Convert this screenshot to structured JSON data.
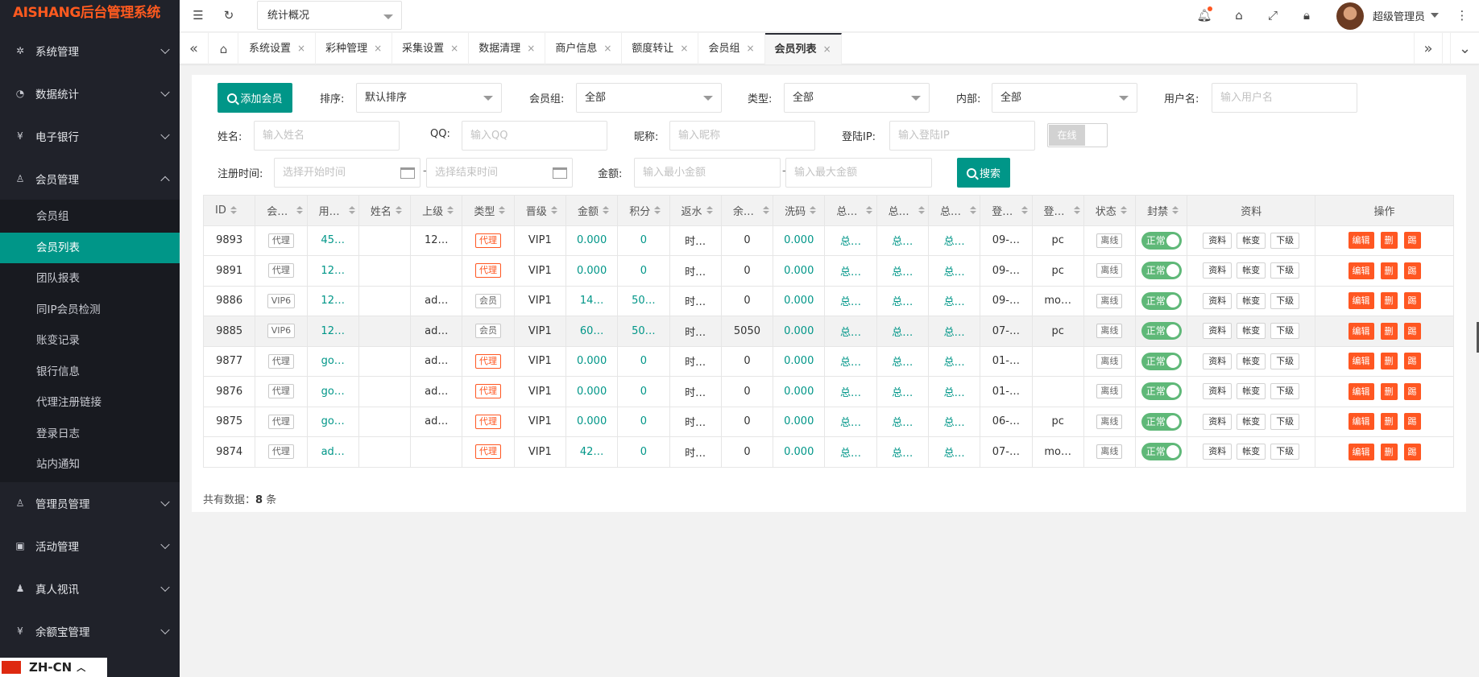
{
  "app": {
    "title": "AISHANG后台管理系统"
  },
  "sidebar": {
    "groups_top": [
      {
        "label": "系统管理",
        "icon": "gear-icon"
      },
      {
        "label": "数据统计",
        "icon": "dashboard-icon"
      },
      {
        "label": "电子银行",
        "icon": "yuan-coin-icon"
      },
      {
        "label": "会员管理",
        "icon": "user-icon",
        "expanded": true
      }
    ],
    "member_items": [
      "会员组",
      "会员列表",
      "团队报表",
      "同IP会员检测",
      "账变记录",
      "银行信息",
      "代理注册链接",
      "登录日志",
      "站内通知"
    ],
    "active_item": "会员列表",
    "groups_bottom": [
      {
        "label": "管理员管理",
        "icon": "user-icon"
      },
      {
        "label": "活动管理",
        "icon": "gift-icon"
      },
      {
        "label": "真人视讯",
        "icon": "users-icon"
      },
      {
        "label": "余额宝管理",
        "icon": "yen-icon"
      }
    ],
    "language": "ZH-CN"
  },
  "topbar": {
    "quick_select": "统计概况",
    "user_name": "超级管理员",
    "accent": "#009688"
  },
  "tabs": [
    "系统设置",
    "彩种管理",
    "采集设置",
    "数据清理",
    "商户信息",
    "额度转让",
    "会员组",
    "会员列表"
  ],
  "active_tab": "会员列表",
  "filters": {
    "add_button": "添加会员",
    "sort_label": "排序:",
    "sort_value": "默认排序",
    "group_label": "会员组:",
    "group_value": "全部",
    "type_label": "类型:",
    "type_value": "全部",
    "internal_label": "内部:",
    "internal_value": "全部",
    "username_label": "用户名:",
    "username_placeholder": "输入用户名",
    "name_label": "姓名:",
    "name_placeholder": "输入姓名",
    "qq_label": "QQ:",
    "qq_placeholder": "输入QQ",
    "nick_label": "昵称:",
    "nick_placeholder": "输入昵称",
    "ip_label": "登陆IP:",
    "ip_placeholder": "输入登陆IP",
    "online_toggle": "在线",
    "regtime_label": "注册时间:",
    "start_placeholder": "选择开始时间",
    "end_placeholder": "选择结束时间",
    "amount_label": "金额:",
    "min_placeholder": "输入最小金额",
    "max_placeholder": "输入最大金额",
    "search_button": "搜索"
  },
  "table": {
    "headers": [
      "ID",
      "会员组",
      "用户名",
      "姓名",
      "上级",
      "类型",
      "晋级",
      "金额",
      "积分",
      "返水",
      "余额宝",
      "洗码",
      "总充值",
      "总提现",
      "总投注",
      "登录时间",
      "登录设备",
      "状态",
      "封禁",
      "资料",
      "操作"
    ],
    "info_buttons": [
      "资料",
      "帐变",
      "下级"
    ],
    "op_buttons": [
      "编辑",
      "删",
      "踢"
    ],
    "rows": [
      {
        "id": "9893",
        "group": "代理",
        "user": "45…",
        "name": "",
        "parent": "12…",
        "type": "代理",
        "level": "VIP1",
        "money": "0.000",
        "points": "0",
        "rebate": "时…",
        "yeb": "0",
        "wash": "0.000",
        "dep": "总…",
        "wd": "总…",
        "bet": "总…",
        "logtime": "09-…",
        "device": "pc",
        "status": "离线",
        "ban": "正常"
      },
      {
        "id": "9891",
        "group": "代理",
        "user": "12…",
        "name": "",
        "parent": "",
        "type": "代理",
        "level": "VIP1",
        "money": "0.000",
        "points": "0",
        "rebate": "时…",
        "yeb": "0",
        "wash": "0.000",
        "dep": "总…",
        "wd": "总…",
        "bet": "总…",
        "logtime": "09-…",
        "device": "pc",
        "status": "离线",
        "ban": "正常"
      },
      {
        "id": "9886",
        "group": "VIP6",
        "user": "12…",
        "name": "",
        "parent": "ad…",
        "type": "会员",
        "level": "VIP1",
        "money": "14…",
        "points": "50…",
        "rebate": "时…",
        "yeb": "0",
        "wash": "0.000",
        "dep": "总…",
        "wd": "总…",
        "bet": "总…",
        "logtime": "09-…",
        "device": "mo…",
        "status": "离线",
        "ban": "正常"
      },
      {
        "id": "9885",
        "group": "VIP6",
        "user": "12…",
        "name": "",
        "parent": "ad…",
        "type": "会员",
        "level": "VIP1",
        "money": "60…",
        "points": "50…",
        "rebate": "时…",
        "yeb": "5050",
        "wash": "0.000",
        "dep": "总…",
        "wd": "总…",
        "bet": "总…",
        "logtime": "07-…",
        "device": "pc",
        "status": "离线",
        "ban": "正常"
      },
      {
        "id": "9877",
        "group": "代理",
        "user": "go…",
        "name": "",
        "parent": "ad…",
        "type": "代理",
        "level": "VIP1",
        "money": "0.000",
        "points": "0",
        "rebate": "时…",
        "yeb": "0",
        "wash": "0.000",
        "dep": "总…",
        "wd": "总…",
        "bet": "总…",
        "logtime": "01-…",
        "device": "",
        "status": "离线",
        "ban": "正常"
      },
      {
        "id": "9876",
        "group": "代理",
        "user": "go…",
        "name": "",
        "parent": "ad…",
        "type": "代理",
        "level": "VIP1",
        "money": "0.000",
        "points": "0",
        "rebate": "时…",
        "yeb": "0",
        "wash": "0.000",
        "dep": "总…",
        "wd": "总…",
        "bet": "总…",
        "logtime": "01-…",
        "device": "",
        "status": "离线",
        "ban": "正常"
      },
      {
        "id": "9875",
        "group": "代理",
        "user": "go…",
        "name": "",
        "parent": "ad…",
        "type": "代理",
        "level": "VIP1",
        "money": "0.000",
        "points": "0",
        "rebate": "时…",
        "yeb": "0",
        "wash": "0.000",
        "dep": "总…",
        "wd": "总…",
        "bet": "总…",
        "logtime": "06-…",
        "device": "pc",
        "status": "离线",
        "ban": "正常"
      },
      {
        "id": "9874",
        "group": "代理",
        "user": "ad…",
        "name": "",
        "parent": "",
        "type": "代理",
        "level": "VIP1",
        "money": "42…",
        "points": "0",
        "rebate": "时…",
        "yeb": "0",
        "wash": "0.000",
        "dep": "总…",
        "wd": "总…",
        "bet": "总…",
        "logtime": "07-…",
        "device": "mo…",
        "status": "离线",
        "ban": "正常"
      }
    ]
  },
  "footer": {
    "count_label": "共有数据：",
    "count": "8",
    "count_unit": " 条"
  }
}
